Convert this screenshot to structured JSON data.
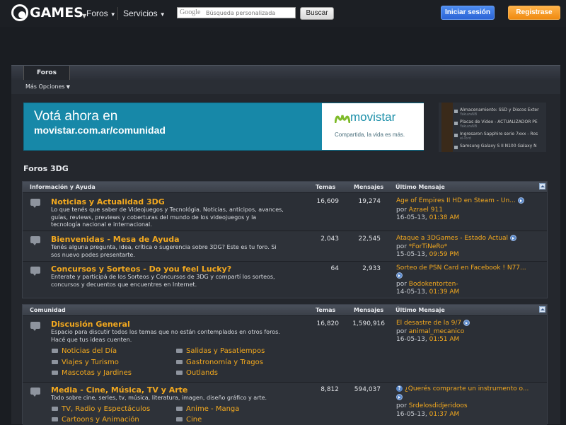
{
  "header": {
    "logo_text": "GAMES",
    "nav": [
      "Foros",
      "Servicios"
    ],
    "search": {
      "google_label": "Google",
      "placeholder": "Búsqueda personalizada",
      "button": "Buscar"
    },
    "login": "Iniciar sesión",
    "register": "Registrase"
  },
  "tabs": {
    "active": "Foros",
    "more_options": "Más Opciones"
  },
  "banner": {
    "line1": "Votá ahora en",
    "line2": "movistar.com.ar/comunidad",
    "brand": "movistar",
    "tagline": "Compartida, la vida es más."
  },
  "side_widget": {
    "items": [
      {
        "title": "Almacenamiento: SSD y Discos Exter",
        "by": "YakuzaNB"
      },
      {
        "title": "Placas de Video - ACTUALIZADOR PE",
        "by": "YakuzaNB"
      },
      {
        "title": "Ingresaron Sapphire serie 7xxx - Ros",
        "by": "el-lord"
      },
      {
        "title": "Samsung Galaxy S II N100 Galaxy N",
        "by": ""
      }
    ]
  },
  "page_title": "Foros 3DG",
  "sections": [
    {
      "title": "Información y Ayuda",
      "col_temas": "Temas",
      "col_mensajes": "Mensajes",
      "col_ultimo": "Último Mensaje",
      "forums": [
        {
          "title": "Noticias y Actualidad 3DG",
          "desc": "Lo que tenés que saber de Videojuegos y Tecnológia. Noticias, anticipos, avances, guías, reviews, previews y coberturas del mundo de los videojuegos y la tecnología nacional e internacional.",
          "temas": "16,609",
          "mensajes": "19,274",
          "last_title": "Age of Empires II HD en Steam - Un...",
          "last_by_prefix": "por",
          "last_user": "Azrael 911",
          "last_date": "16-05-13,",
          "last_time": "01:38 AM"
        },
        {
          "title": "Bienvenidas - Mesa de Ayuda",
          "desc": "Tenés alguna pregunta, idea, crítica o sugerencia sobre 3DG? Este es tu foro. Si sos nuevo podes presentarte.",
          "temas": "2,043",
          "mensajes": "22,545",
          "last_title": "Ataque a 3DGames - Estado Actual",
          "last_by_prefix": "por",
          "last_user": "*ForTiNeRo*",
          "last_date": "15-05-13,",
          "last_time": "09:59 PM"
        },
        {
          "title": "Concursos y Sorteos - Do you feel Lucky?",
          "desc": "Enterate y participá de los Sorteos y Concursos de 3DG y compartí los sorteos, concursos y decuentos que encuentres en Internet.",
          "temas": "64",
          "mensajes": "2,933",
          "last_title": "Sorteo de PSN Card en Facebook ! N77...",
          "last_by_prefix": "por",
          "last_user": "Bodokentorten-",
          "last_date": "14-05-13,",
          "last_time": "01:39 AM"
        }
      ]
    },
    {
      "title": "Comunidad",
      "col_temas": "Temas",
      "col_mensajes": "Mensajes",
      "col_ultimo": "Último Mensaje",
      "forums": [
        {
          "title": "Discusión General",
          "desc": "Espacio para discutir todos los temas que no están contemplados en otros foros. Hacé que tus ideas cuenten.",
          "temas": "16,820",
          "mensajes": "1,590,916",
          "last_title": "El desastre de la 9/7",
          "last_by_prefix": "por",
          "last_user": "animal_mecanico",
          "last_date": "16-05-13,",
          "last_time": "01:51 AM",
          "subforums": [
            "Noticias del Día",
            "Salidas y Pasatiempos",
            "Viajes y Turismo",
            "Gastronomía y Tragos",
            "Mascotas y Jardines",
            "Outlands"
          ]
        },
        {
          "title": "Media - Cine, Música, TV y Arte",
          "desc": "Todo sobre cine, series, tv, música, literatura, imagen, diseño gráfico y arte.",
          "temas": "8,812",
          "mensajes": "594,037",
          "last_title": "¿Querés comprarte un instrumento o...",
          "last_by_prefix": "por",
          "last_user": "Srdelosdidjeridoos",
          "last_date": "16-05-13,",
          "last_time": "01:37 AM",
          "subforums": [
            "TV, Radio y Espectáculos",
            "Anime - Manga",
            "Cartoons y Animación",
            "Cine"
          ]
        }
      ]
    }
  ]
}
